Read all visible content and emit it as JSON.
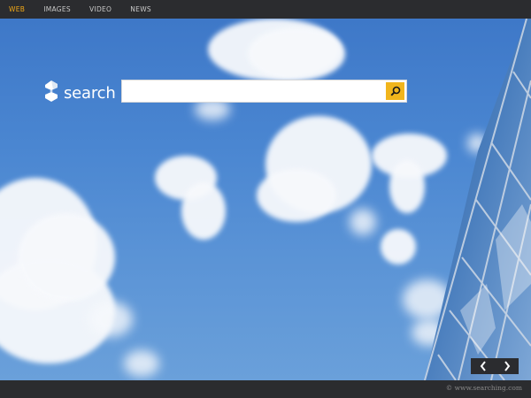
{
  "nav": {
    "tabs": [
      {
        "label": "WEB",
        "active": true
      },
      {
        "label": "IMAGES",
        "active": false
      },
      {
        "label": "VIDEO",
        "active": false
      },
      {
        "label": "NEWS",
        "active": false
      }
    ]
  },
  "logo": {
    "text": "search",
    "icon": "s-logo-icon"
  },
  "search": {
    "value": "",
    "placeholder": "",
    "button_icon": "magnifier-icon"
  },
  "slider": {
    "prev_icon": "chevron-left-icon",
    "next_icon": "chevron-right-icon"
  },
  "footer": {
    "copyright": "© www.searching.com"
  },
  "colors": {
    "accent": "#f1b51c",
    "active_tab": "#f1a817",
    "bar": "#2b2c2f",
    "sky": "#4a86d1"
  }
}
